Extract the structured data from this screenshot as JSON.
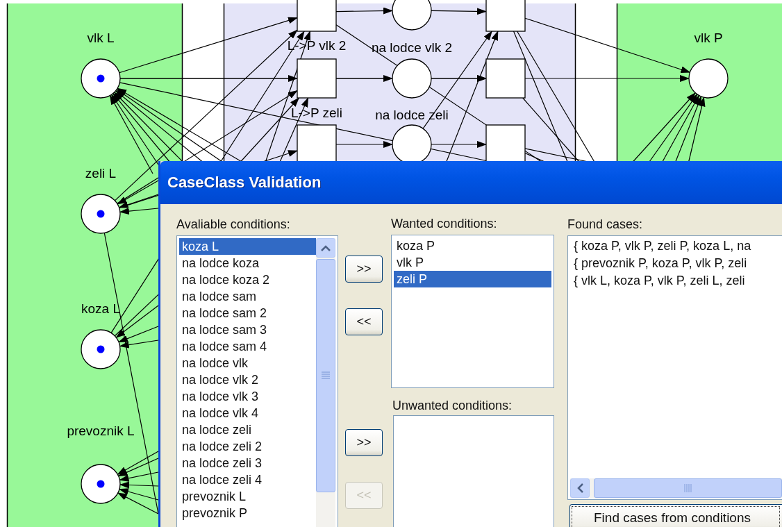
{
  "diagram": {
    "places": [
      {
        "label": "vlk L",
        "token": true
      },
      {
        "label": "zeli L",
        "token": true
      },
      {
        "label": "koza L",
        "token": true
      },
      {
        "label": "prevoznik L",
        "token": true
      },
      {
        "label": "vlk P",
        "token": false
      },
      {
        "token": false
      },
      {
        "label": "na lodce vlk 2",
        "token": false
      },
      {
        "label": "na lodce zeli",
        "token": false
      }
    ],
    "transitions": [
      {
        "kind": "square"
      },
      {
        "kind": "square",
        "label": "L->P vlk 2"
      },
      {
        "kind": "square",
        "label": "L->P zeli"
      },
      {
        "kind": "square"
      },
      {
        "kind": "square"
      },
      {
        "kind": "square"
      }
    ]
  },
  "dialog": {
    "title": "CaseClass Validation",
    "available": {
      "label": "Avaliable conditions:",
      "items": [
        {
          "text": "koza L",
          "selected": true
        },
        {
          "text": "na lodce koza",
          "selected": false
        },
        {
          "text": "na lodce koza 2",
          "selected": false
        },
        {
          "text": "na lodce sam",
          "selected": false
        },
        {
          "text": "na lodce sam 2",
          "selected": false
        },
        {
          "text": "na lodce sam 3",
          "selected": false
        },
        {
          "text": "na lodce sam 4",
          "selected": false
        },
        {
          "text": "na lodce vlk",
          "selected": false
        },
        {
          "text": "na lodce vlk 2",
          "selected": false
        },
        {
          "text": "na lodce vlk 3",
          "selected": false
        },
        {
          "text": "na lodce vlk 4",
          "selected": false
        },
        {
          "text": "na lodce zeli",
          "selected": false
        },
        {
          "text": "na lodce zeli 2",
          "selected": false
        },
        {
          "text": "na lodce zeli 3",
          "selected": false
        },
        {
          "text": "na lodce zeli 4",
          "selected": false
        },
        {
          "text": "prevoznik L",
          "selected": false
        },
        {
          "text": "prevoznik P",
          "selected": false
        }
      ]
    },
    "wanted": {
      "label": "Wanted conditions:",
      "add_button": {
        "label": ">>",
        "disabled": false
      },
      "remove_button": {
        "label": "<<",
        "disabled": false
      },
      "items": [
        {
          "text": "koza P",
          "selected": false
        },
        {
          "text": "vlk P",
          "selected": false
        },
        {
          "text": "zeli P",
          "selected": true
        }
      ]
    },
    "unwanted": {
      "label": "Unwanted conditions:",
      "add_button": {
        "label": ">>",
        "disabled": false
      },
      "remove_button": {
        "label": "<<",
        "disabled": true
      }
    },
    "found": {
      "label": "Found cases:",
      "lines": [
        "{ koza P, vlk P, zeli P, koza L, na",
        "{ prevoznik P, koza P, vlk P, zeli",
        "{ vlk L, koza P, vlk P, zeli L, zeli"
      ]
    },
    "find_button": {
      "label": "Find cases from conditions",
      "focused": true
    }
  }
}
